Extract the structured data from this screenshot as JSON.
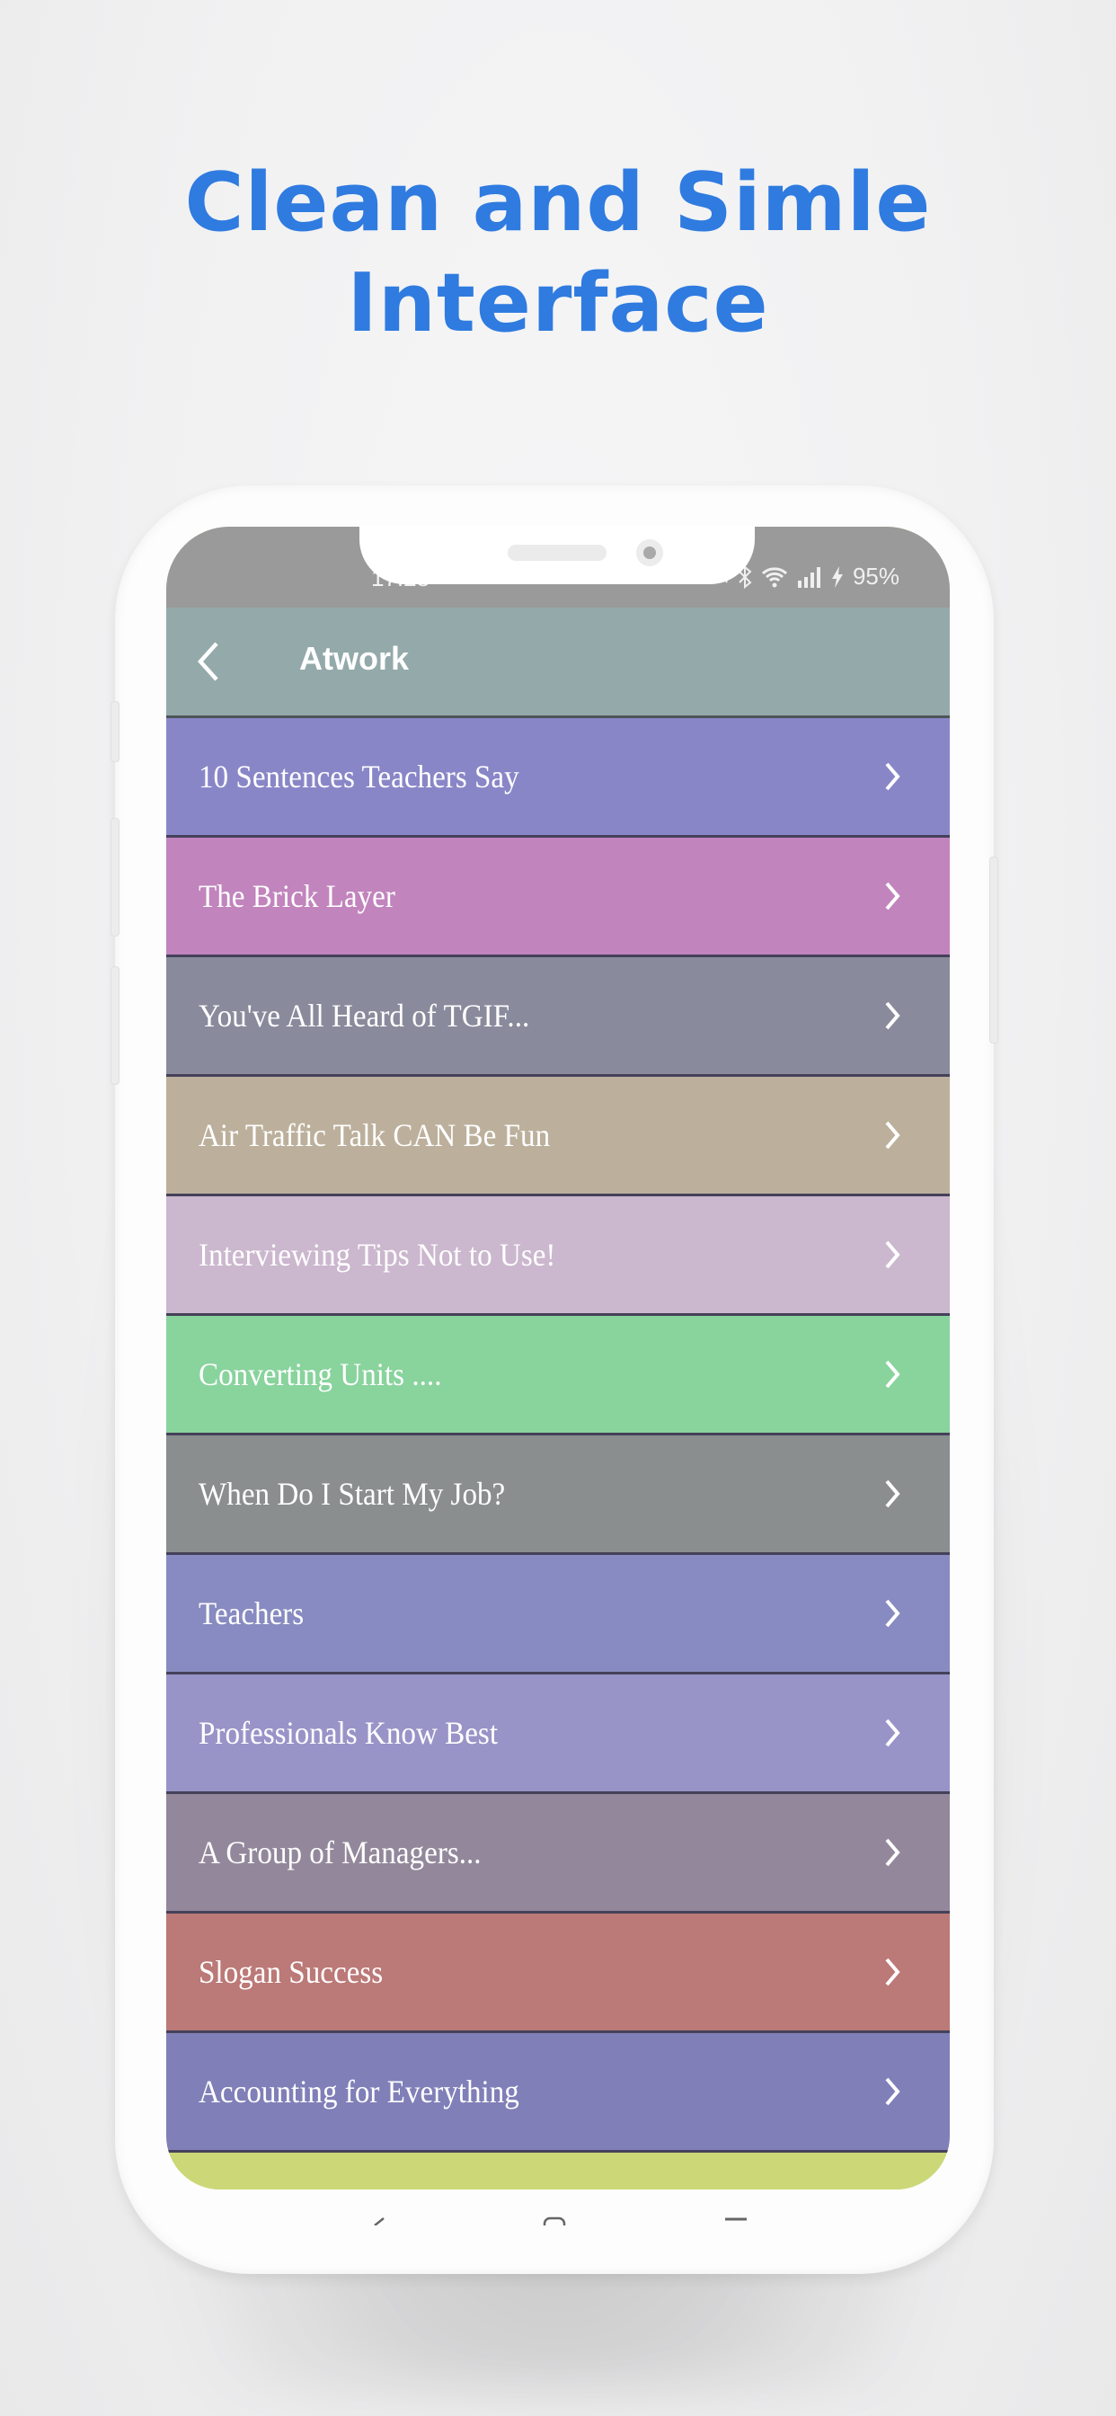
{
  "headline": {
    "line1": "Clean and Simle",
    "line2": "Interface"
  },
  "status_bar": {
    "time": "17:28",
    "battery": "95%",
    "icons": [
      "notification-dot-icon",
      "mute-icon",
      "bluetooth-icon",
      "wifi-icon",
      "signal-icon",
      "charging-icon"
    ]
  },
  "app_bar": {
    "title": "Atwork",
    "back_icon": "chevron-left-icon"
  },
  "list": {
    "items": [
      {
        "label": "10 Sentences Teachers Say",
        "color": "#8986c8"
      },
      {
        "label": "The Brick Layer",
        "color": "#c184bd"
      },
      {
        "label": "You've All Heard of TGIF...",
        "color": "#898b9c"
      },
      {
        "label": "Air Traffic Talk CAN Be Fun",
        "color": "#bcb09c"
      },
      {
        "label": "Interviewing Tips Not to Use!",
        "color": "#cbb7ce"
      },
      {
        "label": "Converting Units ....",
        "color": "#89d39d"
      },
      {
        "label": "When Do I Start My Job?",
        "color": "#8a8e8f"
      },
      {
        "label": "Teachers",
        "color": "#888bc1"
      },
      {
        "label": "Professionals Know Best",
        "color": "#9894c8"
      },
      {
        "label": "A Group of Managers...",
        "color": "#93889b"
      },
      {
        "label": "Slogan Success",
        "color": "#bb7977"
      },
      {
        "label": "Accounting for Everything",
        "color": "#807fb8"
      },
      {
        "label": "",
        "color": "#ccd878"
      }
    ]
  },
  "nav_bar": {
    "icons": [
      "back-nav-icon",
      "home-nav-icon",
      "recents-nav-icon"
    ]
  }
}
